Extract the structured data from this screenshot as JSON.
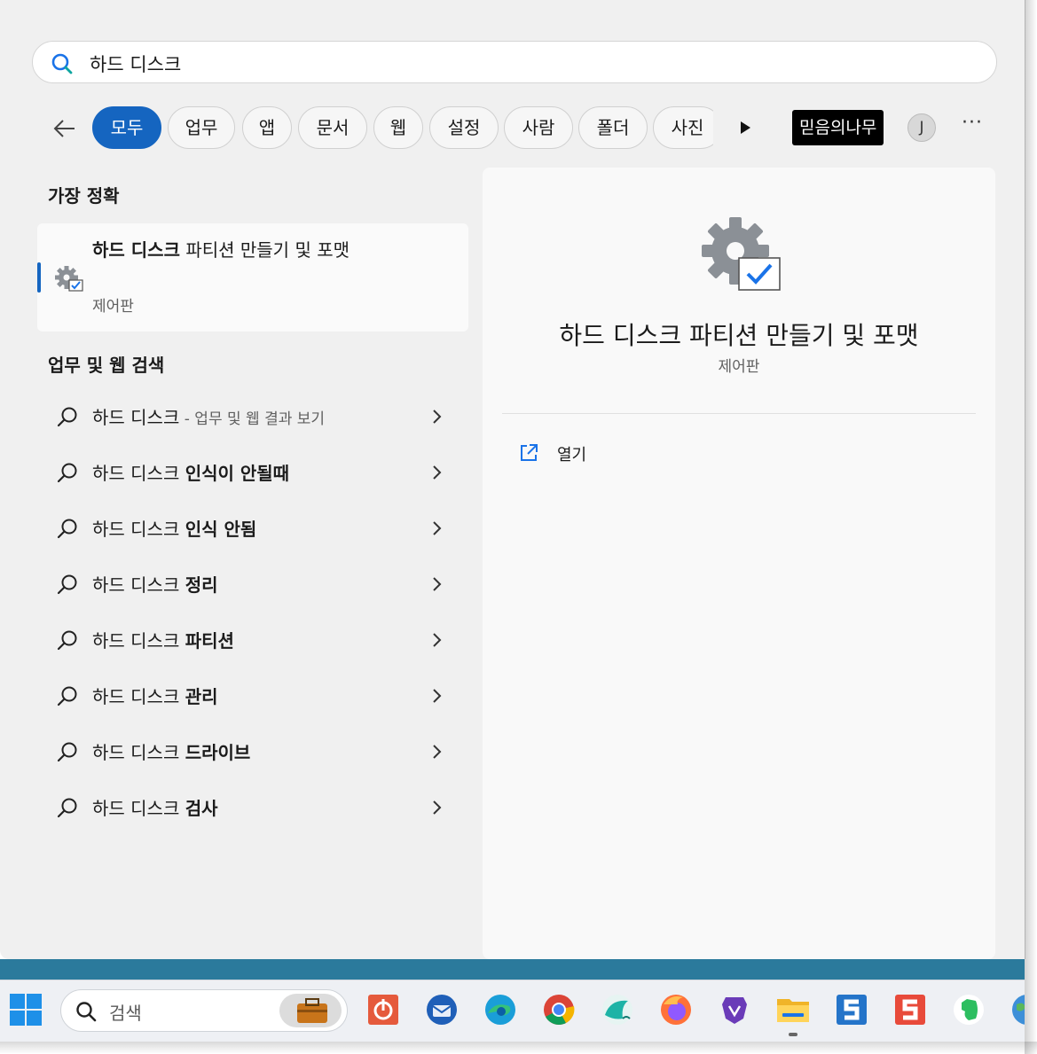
{
  "search": {
    "query": "하드 디스크"
  },
  "filters": {
    "back_label": "←",
    "tabs": [
      {
        "label": "모두",
        "active": true
      },
      {
        "label": "업무"
      },
      {
        "label": "앱"
      },
      {
        "label": "문서"
      },
      {
        "label": "웹"
      },
      {
        "label": "설정"
      },
      {
        "label": "사람"
      },
      {
        "label": "폴더"
      },
      {
        "label": "사진"
      }
    ],
    "account_name": "믿음의나무",
    "avatar_letter": "J",
    "more_label": "···"
  },
  "best_match": {
    "section_title": "가장 정확",
    "title_bold": "하드 디스크",
    "title_rest": " 파티션 만들기 및 포맷",
    "subtitle": "제어판"
  },
  "web_search": {
    "section_title": "업무 및 웹 검색",
    "items": [
      {
        "prefix": "하드 디스크",
        "bold": "",
        "hint": " - 업무 및 웹 결과 보기"
      },
      {
        "prefix": "하드 디스크 ",
        "bold": "인식이 안될때",
        "hint": ""
      },
      {
        "prefix": "하드 디스크 ",
        "bold": "인식 안됨",
        "hint": ""
      },
      {
        "prefix": "하드 디스크 ",
        "bold": "정리",
        "hint": ""
      },
      {
        "prefix": "하드 디스크 ",
        "bold": "파티션",
        "hint": ""
      },
      {
        "prefix": "하드 디스크 ",
        "bold": "관리",
        "hint": ""
      },
      {
        "prefix": "하드 디스크 ",
        "bold": "드라이브",
        "hint": ""
      },
      {
        "prefix": "하드 디스크 ",
        "bold": "검사",
        "hint": ""
      }
    ]
  },
  "detail": {
    "title": "하드 디스크 파티션 만들기 및 포맷",
    "subtitle": "제어판",
    "open_label": "열기"
  },
  "taskbar": {
    "search_placeholder": "검색",
    "apps": [
      "start-icon",
      "power-app-icon",
      "thunderbird-icon",
      "edge-icon",
      "chrome-icon",
      "whale-browser-icon",
      "firefox-icon",
      "brave-nightly-icon",
      "file-explorer-icon",
      "s-app-blue-icon",
      "s-app-red-icon",
      "evernote-icon",
      "globe-app-icon"
    ]
  },
  "colors": {
    "accent": "#1565c0",
    "panel": "#f0f0f0",
    "taskbar_strip": "#2b7a9c"
  }
}
